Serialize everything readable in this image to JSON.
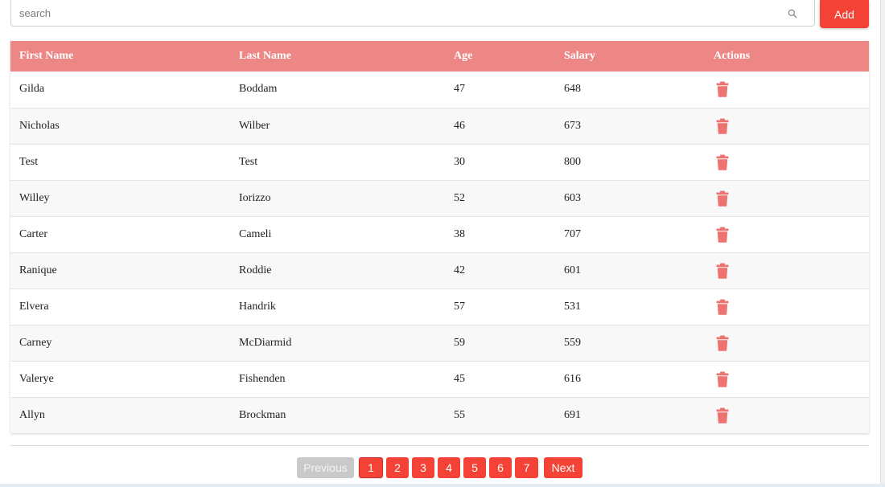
{
  "search": {
    "placeholder": "search",
    "value": "",
    "icon": "search-icon"
  },
  "toolbar": {
    "add_label": "Add"
  },
  "colors": {
    "accent": "#f44336",
    "header_bg": "#ec8785",
    "trash_icon": "#ec7370"
  },
  "table": {
    "columns": [
      "First Name",
      "Last Name",
      "Age",
      "Salary",
      "Actions"
    ],
    "rows": [
      {
        "first": "Gilda",
        "last": "Boddam",
        "age": "47",
        "salary": "648",
        "action_icon": "trash-icon"
      },
      {
        "first": "Nicholas",
        "last": "Wilber",
        "age": "46",
        "salary": "673",
        "action_icon": "trash-icon"
      },
      {
        "first": "Test",
        "last": "Test",
        "age": "30",
        "salary": "800",
        "action_icon": "trash-icon"
      },
      {
        "first": "Willey",
        "last": "Iorizzo",
        "age": "52",
        "salary": "603",
        "action_icon": "trash-icon"
      },
      {
        "first": "Carter",
        "last": "Cameli",
        "age": "38",
        "salary": "707",
        "action_icon": "trash-icon"
      },
      {
        "first": "Ranique",
        "last": "Roddie",
        "age": "42",
        "salary": "601",
        "action_icon": "trash-icon"
      },
      {
        "first": "Elvera",
        "last": "Handrik",
        "age": "57",
        "salary": "531",
        "action_icon": "trash-icon"
      },
      {
        "first": "Carney",
        "last": "McDiarmid",
        "age": "59",
        "salary": "559",
        "action_icon": "trash-icon"
      },
      {
        "first": "Valerye",
        "last": "Fishenden",
        "age": "45",
        "salary": "616",
        "action_icon": "trash-icon"
      },
      {
        "first": "Allyn",
        "last": "Brockman",
        "age": "55",
        "salary": "691",
        "action_icon": "trash-icon"
      }
    ]
  },
  "pagination": {
    "previous_label": "Previous",
    "next_label": "Next",
    "pages": [
      "1",
      "2",
      "3",
      "4",
      "5",
      "6",
      "7"
    ],
    "current_page": "1"
  }
}
